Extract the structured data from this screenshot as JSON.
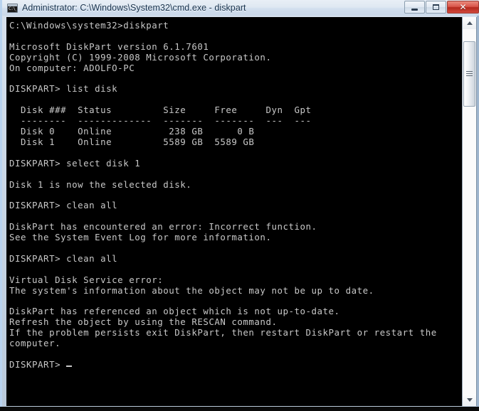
{
  "window": {
    "title": "Administrator: C:\\Windows\\System32\\cmd.exe - diskpart",
    "icon_name": "cmd-console-icon",
    "icon_glyph": "C:\\_",
    "controls": {
      "minimize_label": "─",
      "maximize_label": "❐",
      "close_label": "✕"
    },
    "colors": {
      "titlebar_start": "#e9eff6",
      "titlebar_end": "#cad9ea",
      "border": "#b9d3ef",
      "console_bg": "#000000",
      "console_fg": "#c8c8c8",
      "close_button": "#b4291d"
    }
  },
  "scrollbar": {
    "up_arrow_label": "▲",
    "down_arrow_label": "▼",
    "thumb_position_percent": 4,
    "thumb_size_percent": 18
  },
  "console": {
    "prompt_symbol": "DISKPART>",
    "cursor_visible": true,
    "lines": [
      "C:\\Windows\\system32>diskpart",
      "",
      "Microsoft DiskPart version 6.1.7601",
      "Copyright (C) 1999-2008 Microsoft Corporation.",
      "On computer: ADOLFO-PC",
      "",
      "DISKPART> list disk",
      "",
      "  Disk ###  Status         Size     Free     Dyn  Gpt",
      "  --------  -------------  -------  -------  ---  ---",
      "  Disk 0    Online          238 GB      0 B",
      "  Disk 1    Online         5589 GB  5589 GB",
      "",
      "DISKPART> select disk 1",
      "",
      "Disk 1 is now the selected disk.",
      "",
      "DISKPART> clean all",
      "",
      "DiskPart has encountered an error: Incorrect function.",
      "See the System Event Log for more information.",
      "",
      "DISKPART> clean all",
      "",
      "Virtual Disk Service error:",
      "The system's information about the object may not be up to date.",
      "",
      "DiskPart has referenced an object which is not up-to-date.",
      "Refresh the object by using the RESCAN command.",
      "If the problem persists exit DiskPart, then restart DiskPart or restart the",
      "computer.",
      "",
      "DISKPART> "
    ],
    "disk_table": {
      "headers": [
        "Disk ###",
        "Status",
        "Size",
        "Free",
        "Dyn",
        "Gpt"
      ],
      "rows": [
        [
          "Disk 0",
          "Online",
          "238 GB",
          "0 B",
          "",
          ""
        ],
        [
          "Disk 1",
          "Online",
          "5589 GB",
          "5589 GB",
          "",
          ""
        ]
      ]
    },
    "commands_entered": [
      "diskpart",
      "list disk",
      "select disk 1",
      "clean all",
      "clean all"
    ],
    "program_name": "Microsoft DiskPart",
    "program_version": "6.1.7601",
    "copyright": "Copyright (C) 1999-2008 Microsoft Corporation.",
    "computer_name": "ADOLFO-PC"
  }
}
